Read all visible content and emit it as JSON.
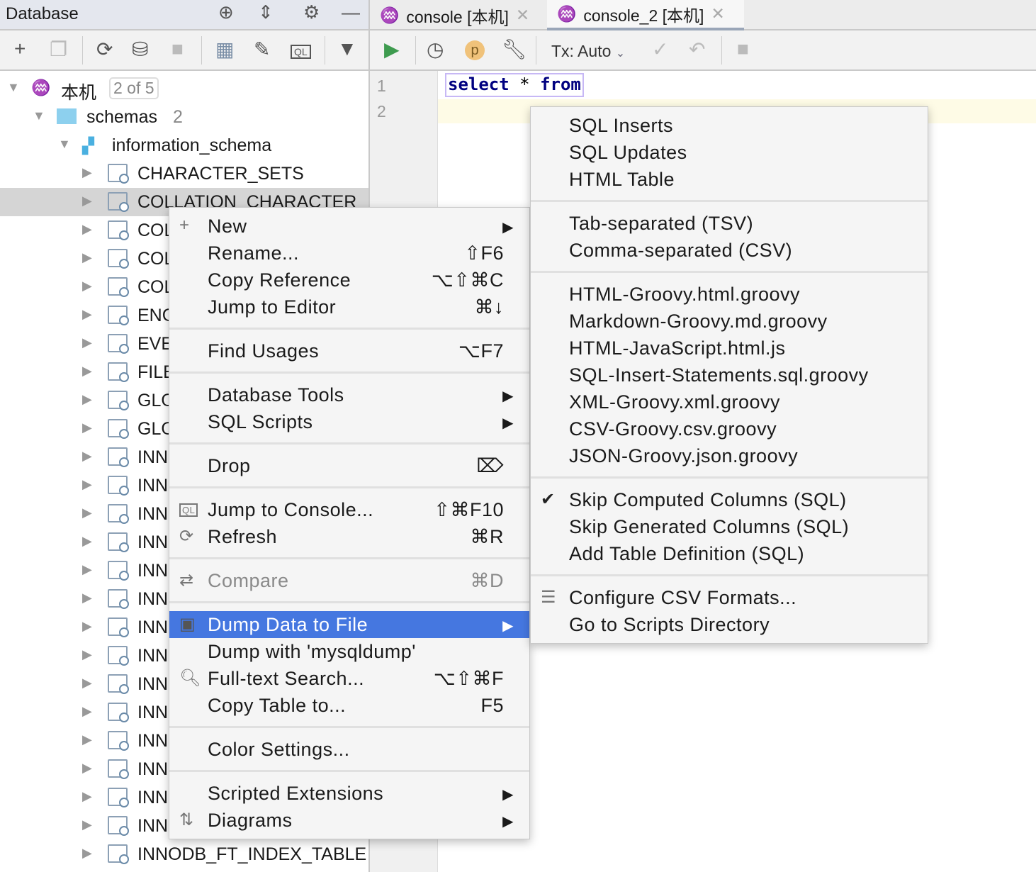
{
  "sidebar": {
    "title": "Database",
    "toolbar_icons": [
      "target-icon",
      "collapse-icon",
      "gear-icon",
      "minimize-icon"
    ],
    "tree": {
      "root": {
        "label": "本机",
        "badge": "2 of 5"
      },
      "schemas": {
        "label": "schemas",
        "count": "2"
      },
      "schema": "information_schema",
      "tables": [
        "CHARACTER_SETS",
        "COLLATION_CHARACTER",
        "COL",
        "COL",
        "COL",
        "ENG",
        "EVE",
        "FILE",
        "GLO",
        "GLO",
        "INN",
        "INN",
        "INN",
        "INN",
        "INN",
        "INN",
        "INN",
        "INN",
        "INN",
        "INN",
        "INN",
        "INN",
        "INN",
        "INN",
        "INNODB_FT_INDEX_TABLE"
      ],
      "selected_index": 1
    }
  },
  "tabs": [
    {
      "label": "console [本机]",
      "active": false
    },
    {
      "label": "console_2 [本机]",
      "active": true
    }
  ],
  "editor_toolbar": {
    "tx_label": "Tx: Auto"
  },
  "editor": {
    "lines": [
      "1",
      "2"
    ],
    "code_keyword1": "select",
    "code_star": " * ",
    "code_keyword2": "from"
  },
  "context_menu": [
    {
      "label": "New",
      "icon": "+",
      "submenu": true
    },
    {
      "label": "Rename...",
      "shortcut": "⇧F6"
    },
    {
      "label": "Copy Reference",
      "shortcut": "⌥⇧⌘C"
    },
    {
      "label": "Jump to Editor",
      "shortcut": "⌘↓"
    },
    {
      "sep": true
    },
    {
      "label": "Find Usages",
      "shortcut": "⌥F7"
    },
    {
      "sep": true
    },
    {
      "label": "Database Tools",
      "submenu": true
    },
    {
      "label": "SQL Scripts",
      "submenu": true
    },
    {
      "sep": true
    },
    {
      "label": "Drop",
      "shortcut": "⌦"
    },
    {
      "sep": true
    },
    {
      "label": "Jump to Console...",
      "shortcut": "⇧⌘F10",
      "icon": "QL"
    },
    {
      "label": "Refresh",
      "shortcut": "⌘R",
      "icon": "⟳"
    },
    {
      "sep": true
    },
    {
      "label": "Compare",
      "shortcut": "⌘D",
      "icon": "⇄",
      "disabled": true
    },
    {
      "sep": true
    },
    {
      "label": "Dump Data to File",
      "submenu": true,
      "icon": "▣",
      "highlighted": true
    },
    {
      "label": "Dump with 'mysqldump'"
    },
    {
      "label": "Full-text Search...",
      "shortcut": "⌥⇧⌘F",
      "icon": "🔍︎"
    },
    {
      "label": "Copy Table to...",
      "shortcut": "F5"
    },
    {
      "sep": true
    },
    {
      "label": "Color Settings..."
    },
    {
      "sep": true
    },
    {
      "label": "Scripted Extensions",
      "submenu": true
    },
    {
      "label": "Diagrams",
      "submenu": true,
      "icon": "⇅"
    }
  ],
  "dump_submenu": [
    {
      "label": "SQL Inserts"
    },
    {
      "label": "SQL Updates"
    },
    {
      "label": "HTML Table"
    },
    {
      "sep": true
    },
    {
      "label": "Tab-separated (TSV)"
    },
    {
      "label": "Comma-separated (CSV)"
    },
    {
      "sep": true
    },
    {
      "label": "HTML-Groovy.html.groovy"
    },
    {
      "label": "Markdown-Groovy.md.groovy"
    },
    {
      "label": "HTML-JavaScript.html.js"
    },
    {
      "label": "SQL-Insert-Statements.sql.groovy"
    },
    {
      "label": "XML-Groovy.xml.groovy"
    },
    {
      "label": "CSV-Groovy.csv.groovy"
    },
    {
      "label": "JSON-Groovy.json.groovy"
    },
    {
      "sep": true
    },
    {
      "label": "Skip Computed Columns (SQL)",
      "checked": true,
      "icon": "✔"
    },
    {
      "label": "Skip Generated Columns (SQL)"
    },
    {
      "label": "Add Table Definition (SQL)"
    },
    {
      "sep": true
    },
    {
      "label": "Configure CSV Formats...",
      "icon": "☰"
    },
    {
      "label": "Go to Scripts Directory"
    }
  ],
  "colors": {
    "highlight": "#4577e0",
    "run": "#3e9b4f",
    "p_badge": "#f0c27a"
  }
}
